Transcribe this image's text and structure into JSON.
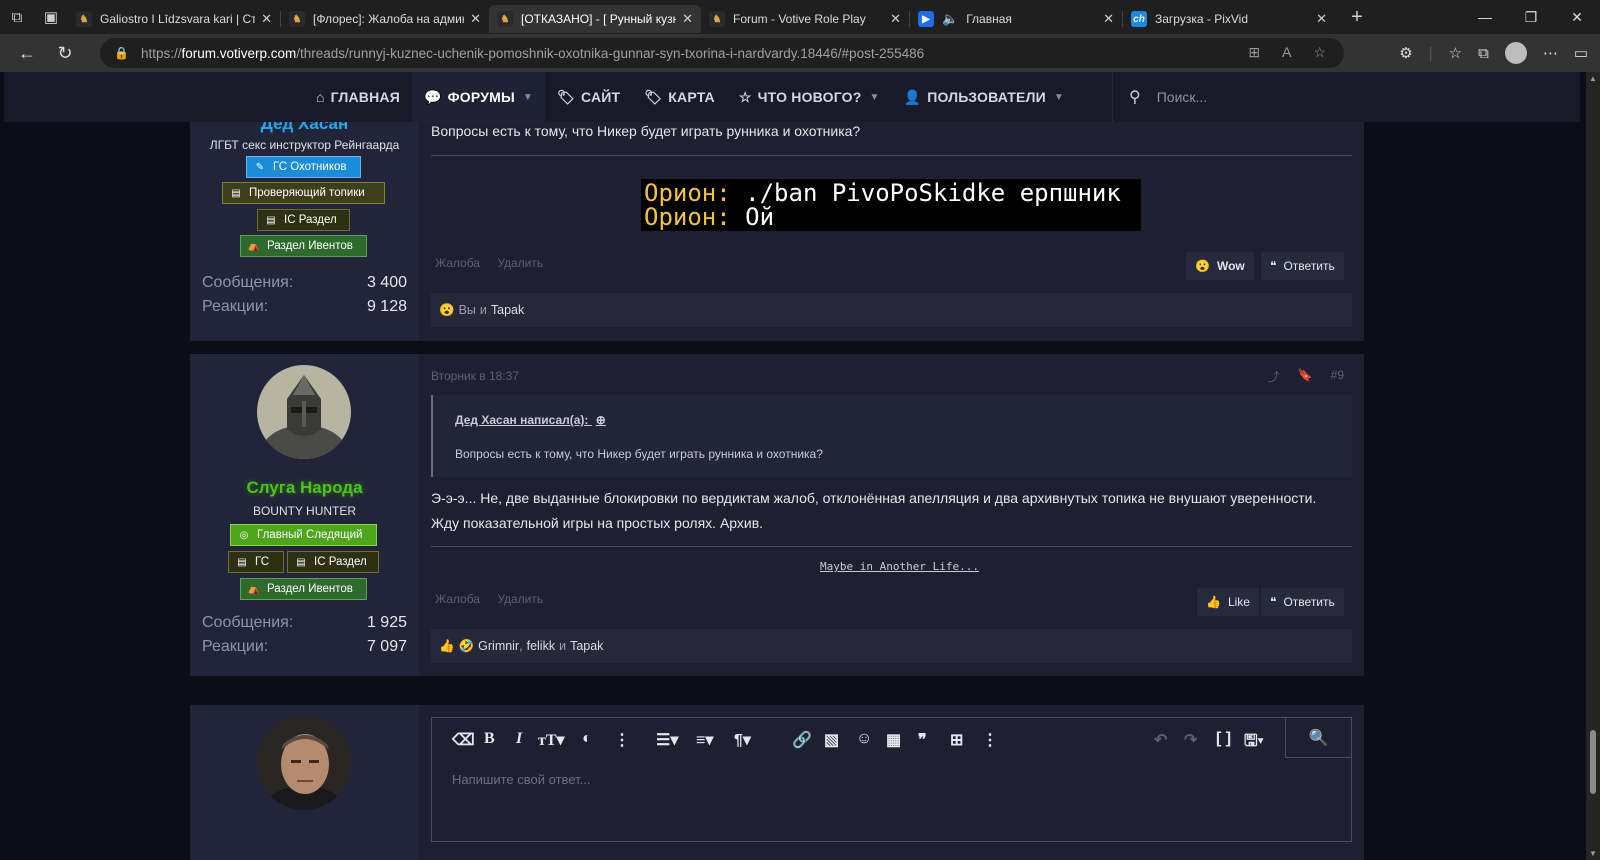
{
  "browser": {
    "tabs": [
      {
        "title": "Galiostro I Līdzsvara kari | Стр",
        "fav_color": "#2a2a2a",
        "fav_text": "🐎"
      },
      {
        "title": "[Флорес]: Жалоба на админ",
        "fav_color": "#2a2a2a",
        "fav_text": "🐎"
      },
      {
        "title": "[ОТКАЗАНО] - [ Рунный кузн",
        "fav_color": "#2a2a2a",
        "fav_text": "🐎"
      },
      {
        "title": "Forum - Votive Role Play",
        "fav_color": "#2a2a2a",
        "fav_text": "🐎"
      },
      {
        "title": "Главная",
        "fav_color": "#1a6ee6",
        "fav_text": "▶"
      },
      {
        "title": "Загрузка - PixVid",
        "fav_color": "#1a8ae6",
        "fav_text": "ch"
      }
    ],
    "url_prefix": "https://",
    "url_host": "forum.votiverp.com",
    "url_path": "/threads/runnyj-kuznec-uchenik-pomoshnik-oxotnika-gunnar-syn-txorina-i-nardvardy.18446/#post-255486"
  },
  "forum_nav": {
    "home": "ГЛАВНАЯ",
    "forums": "ФОРУМЫ",
    "site": "САЙТ",
    "map": "КАРТА",
    "whats_new": "ЧТО НОВОГО?",
    "users": "ПОЛЬЗОВАТЕЛИ",
    "search_placeholder": "Поиск..."
  },
  "post1": {
    "username": "Дед Хасан",
    "user_title": "ЛГБТ секс инструктор Рейнгаарда",
    "badges": [
      "ГС Охотников",
      "Проверяющий топики",
      "IC Раздел",
      "Раздел Ивентов"
    ],
    "messages_label": "Сообщения:",
    "messages": "3 400",
    "reactions_label": "Реакции:",
    "reactions": "9 128",
    "text": "Вопросы есть к тому, что Никер будет играть рунника и охотника?",
    "image_line1_who": "Орион:",
    "image_line1_msg": " ./ban PivoPoSkidke ерпшник",
    "image_line2_who": "Орион:",
    "image_line2_msg": " Ой",
    "report": "Жалоба",
    "delete": "Удалить",
    "react_btn": "Wow",
    "reply_btn": "Ответить",
    "reacted_you": "Вы",
    "reacted_and": "и",
    "reacted_user": "Tapak"
  },
  "post2": {
    "username": "Слуга Народа",
    "user_title": "BOUNTY HUNTER",
    "badges": [
      "Главный Следящий",
      "ГС",
      "IC Раздел",
      "Раздел Ивентов"
    ],
    "messages_label": "Сообщения:",
    "messages": "1 925",
    "reactions_label": "Реакции:",
    "reactions": "7 097",
    "date": "Вторник в 18:37",
    "post_number": "#9",
    "quote_header": "Дед Хасан написал(а):",
    "quote_text": "Вопросы есть к тому, что Никер будет играть рунника и охотника?",
    "text_line1": "Э-э-э... Не, две выданные блокировки по вердиктам жалоб, отклонённая апелляция и два архивнутых топика не внушают уверенности.",
    "text_line2": "Жду показательной игры на простых ролях. Архив.",
    "signature": "Maybe in Another Life...",
    "report": "Жалоба",
    "delete": "Удалить",
    "like_btn": "Like",
    "reply_btn": "Ответить",
    "reacted_users": [
      "Grimnir",
      "felikk",
      "Tapak"
    ],
    "reacted_comma": ",",
    "reacted_and": "и"
  },
  "editor": {
    "placeholder": "Напишите свой ответ..."
  },
  "colors": {
    "username_blue": "#20a8f0",
    "username_green": "#4ec21a",
    "page_bg": "#0c0d16",
    "post_bg": "#1e2031"
  }
}
